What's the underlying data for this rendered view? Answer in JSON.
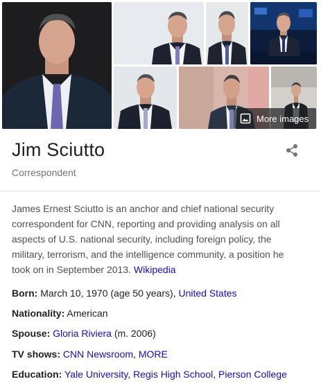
{
  "knowledge_panel": {
    "title": "Jim Sciutto",
    "subtitle": "Correspondent",
    "more_images_label": "More images",
    "description": {
      "text": "James Ernest Sciutto is an anchor and chief national security correspondent for CNN, reporting and providing analysis on all aspects of U.S. national security, including foreign policy, the military, terrorism, and the intelligence community, a position he took on in September 2013.",
      "source_link": "Wikipedia"
    },
    "facts": {
      "born": {
        "label": "Born:",
        "value": "March 10, 1970 (age 50 years),",
        "link": "United States"
      },
      "nationality": {
        "label": "Nationality:",
        "value": "American"
      },
      "spouse": {
        "label": "Spouse:",
        "link": "Gloria Riviera",
        "value": "(m. 2006)"
      },
      "tv_shows": {
        "label": "TV shows:",
        "links": [
          "CNN Newsroom",
          "MORE"
        ]
      },
      "education": {
        "label": "Education:",
        "links": [
          "Yale University",
          "Regis High School",
          "Pierson College"
        ]
      }
    },
    "colors": {
      "link": "#1a0dab",
      "text": "#202124",
      "muted": "#70757a",
      "body": "#4d5156"
    },
    "icons": {
      "share": "share-icon",
      "more_images": "image-icon"
    }
  }
}
